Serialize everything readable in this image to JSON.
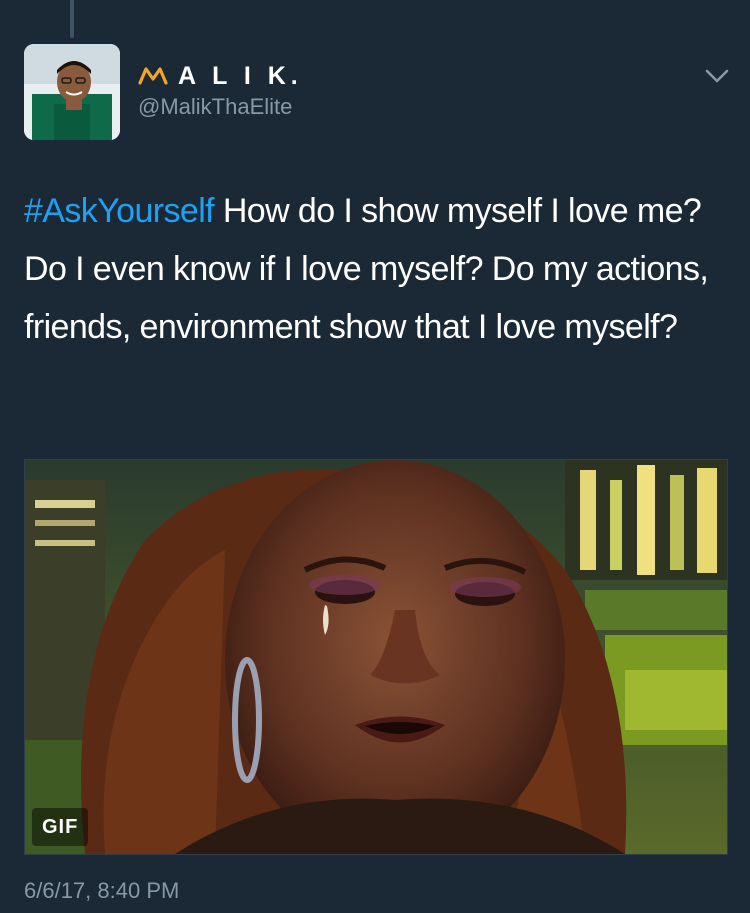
{
  "tweet": {
    "display_name": "A L I K.",
    "handle": "@MalikThaElite",
    "hashtag": "#AskYourself",
    "text": " How do I show myself I love me? Do I even know if I love myself? Do my actions, friends, environment show that I love myself?",
    "media_badge": "GIF",
    "timestamp": "6/6/17, 8:40 PM"
  },
  "icons": {
    "name_prefix": "crown-icon",
    "menu": "chevron-down-icon"
  },
  "colors": {
    "background": "#1b2836",
    "hashtag": "#1da1f2",
    "secondary_text": "#8899a6",
    "crown": "#f5a623"
  }
}
